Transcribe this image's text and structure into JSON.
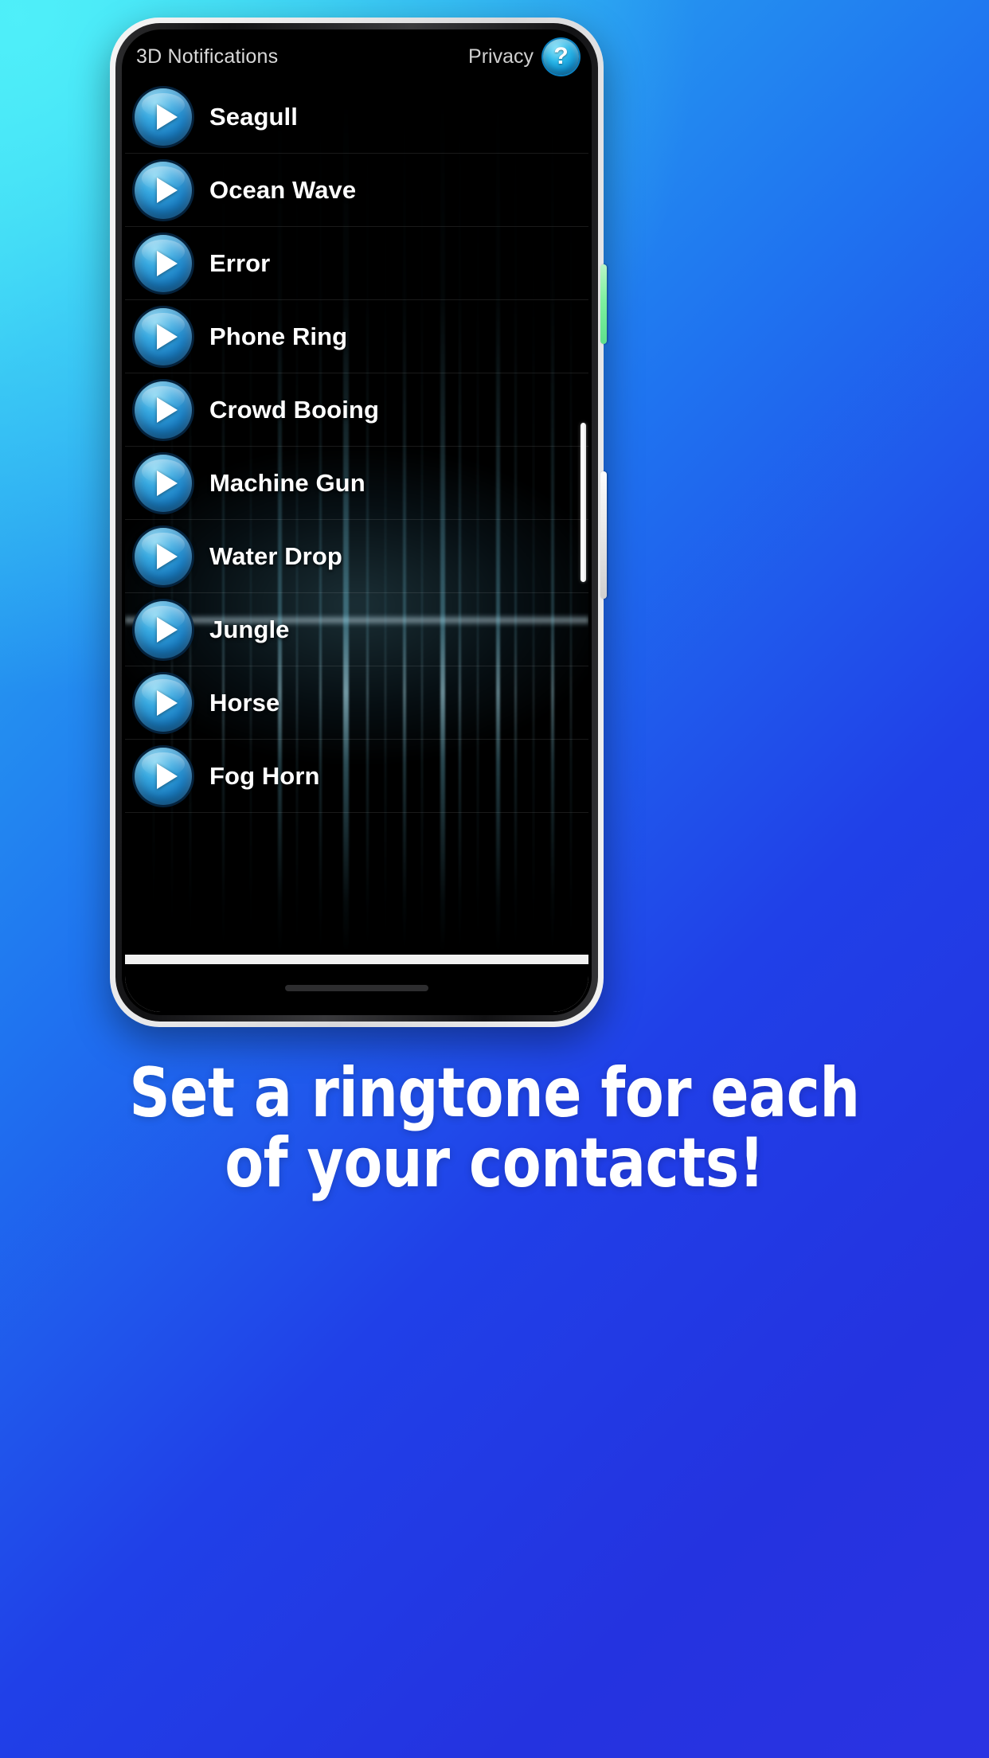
{
  "background": {
    "gradient_from": "#3ce0ee",
    "gradient_to": "#2b33e2"
  },
  "device": {
    "frame_color": "#e9e9ea",
    "side_buttons": [
      {
        "name": "volume",
        "color": "#7ff0a0"
      },
      {
        "name": "power",
        "color": "#f2f2f2"
      }
    ]
  },
  "app": {
    "header": {
      "title": "3D Notifications",
      "privacy_label": "Privacy",
      "help_icon": "?",
      "help_color": "#29b6e8"
    },
    "sounds": [
      {
        "name": "Seagull",
        "icon": "play-icon"
      },
      {
        "name": "Ocean Wave",
        "icon": "play-icon"
      },
      {
        "name": "Error",
        "icon": "play-icon"
      },
      {
        "name": "Phone Ring",
        "icon": "play-icon"
      },
      {
        "name": "Crowd Booing",
        "icon": "play-icon"
      },
      {
        "name": "Machine Gun",
        "icon": "play-icon"
      },
      {
        "name": "Water Drop",
        "icon": "play-icon"
      },
      {
        "name": "Jungle",
        "icon": "play-icon"
      },
      {
        "name": "Horse",
        "icon": "play-icon"
      },
      {
        "name": "Fog Horn",
        "icon": "play-icon"
      }
    ],
    "accent_color": "#1b7fc4"
  },
  "system_nav": {
    "recents_icon": "recents-icon",
    "home_icon": "home-icon",
    "back_icon": "back-icon",
    "bar_color": "#f1f1f1"
  },
  "tagline": {
    "line1": "Set a ringtone for each",
    "line2": "of your contacts!",
    "color": "#ffffff"
  }
}
